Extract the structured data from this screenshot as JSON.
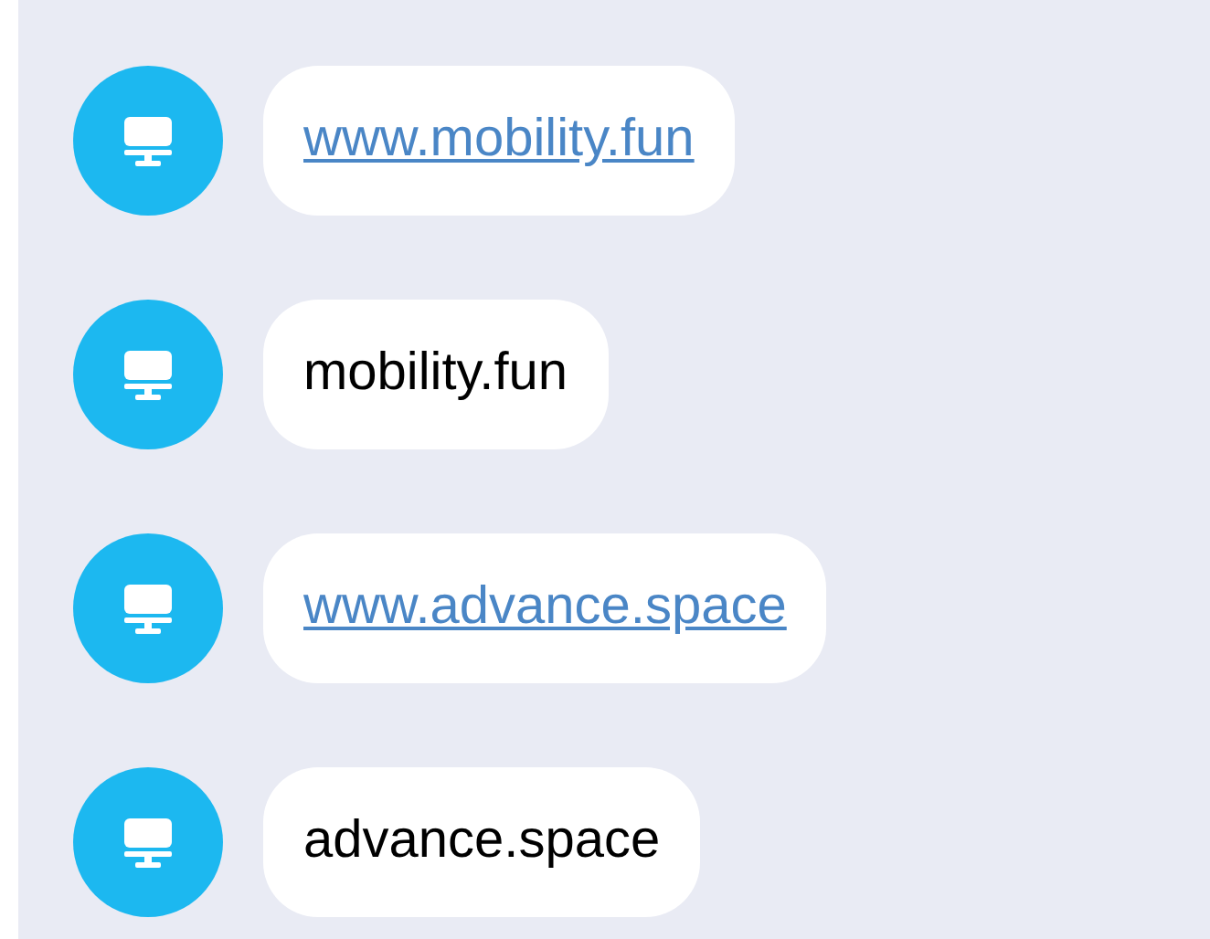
{
  "messages": [
    {
      "kind": "link",
      "text": "www.mobility.fun"
    },
    {
      "kind": "text",
      "text": "mobility.fun"
    },
    {
      "kind": "link",
      "text": "www.advance.space"
    },
    {
      "kind": "text",
      "text": "advance.space"
    }
  ]
}
